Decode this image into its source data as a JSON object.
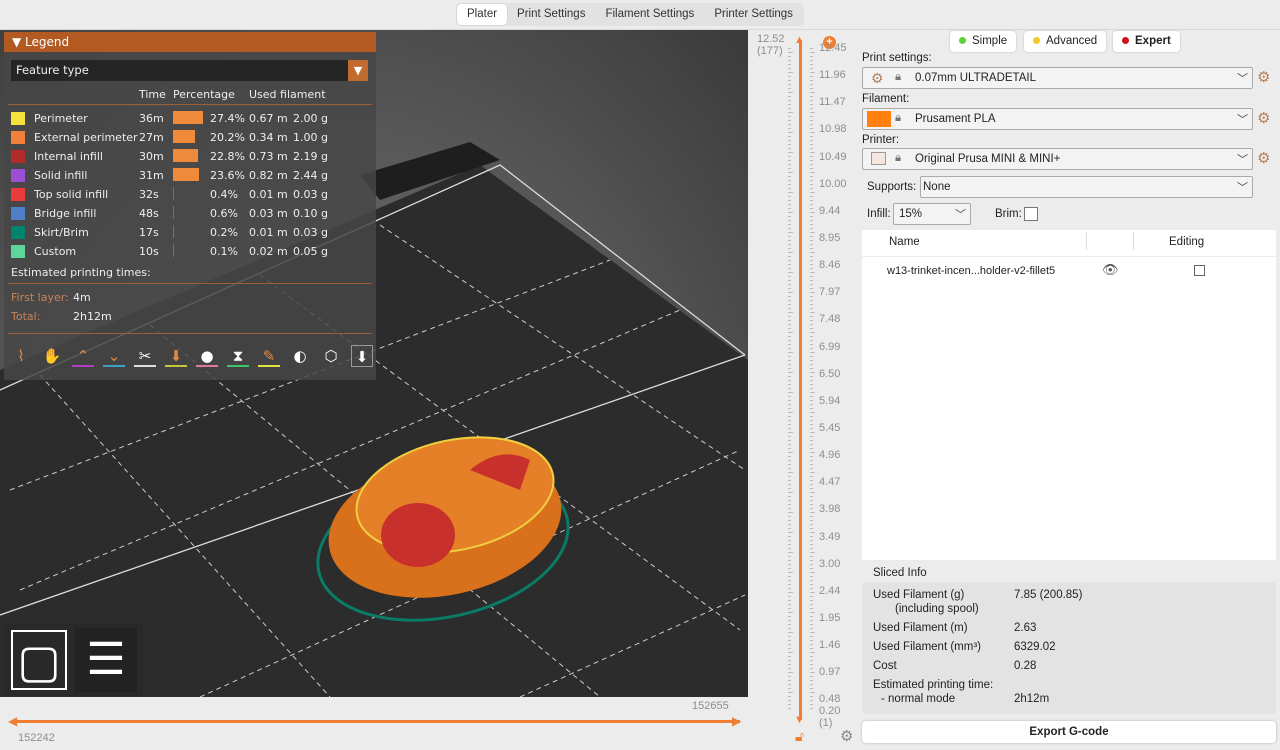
{
  "tabs": [
    "Plater",
    "Print Settings",
    "Filament Settings",
    "Printer Settings"
  ],
  "legend": {
    "title": "Legend",
    "view_type": "Feature type",
    "headers": {
      "time": "Time",
      "percentage": "Percentage",
      "used_filament": "Used filament"
    },
    "rows": [
      {
        "name": "Perimeter",
        "color": "#f5e33b",
        "time": "36m",
        "pct": "27.4%",
        "pct_value": 27.4,
        "m": "0.67 m",
        "g": "2.00 g"
      },
      {
        "name": "External perimeter",
        "color": "#f0803a",
        "time": "27m",
        "pct": "20.2%",
        "pct_value": 20.2,
        "m": "0.34 m",
        "g": "1.00 g"
      },
      {
        "name": "Internal infill",
        "color": "#b22b2b",
        "time": "30m",
        "pct": "22.8%",
        "pct_value": 22.8,
        "m": "0.73 m",
        "g": "2.19 g"
      },
      {
        "name": "Solid infill",
        "color": "#9a4fd4",
        "time": "31m",
        "pct": "23.6%",
        "pct_value": 23.6,
        "m": "0.82 m",
        "g": "2.44 g"
      },
      {
        "name": "Top solid infill",
        "color": "#eb3a3a",
        "time": "32s",
        "pct": "0.4%",
        "pct_value": 0.4,
        "m": "0.01 m",
        "g": "0.03 g"
      },
      {
        "name": "Bridge infill",
        "color": "#4f7fc6",
        "time": "48s",
        "pct": "0.6%",
        "pct_value": 0.6,
        "m": "0.03 m",
        "g": "0.10 g"
      },
      {
        "name": "Skirt/Brim",
        "color": "#00846d",
        "time": "17s",
        "pct": "0.2%",
        "pct_value": 0.2,
        "m": "0.01 m",
        "g": "0.03 g"
      },
      {
        "name": "Custom",
        "color": "#5ed59a",
        "time": "10s",
        "pct": "0.1%",
        "pct_value": 0.1,
        "m": "0.02 m",
        "g": "0.05 g"
      }
    ],
    "estimated_label": "Estimated printing times:",
    "first_layer_label": "First layer:",
    "first_layer": "4m",
    "total_label": "Total:",
    "total": "2h12m",
    "toolbar_icons": [
      "travel-icon",
      "wipe-icon",
      "retractions-icon",
      "deretractions-icon",
      "seams-icon",
      "tool-changes-icon",
      "color-changes-icon",
      "pause-icon",
      "custom-gcode-icon",
      "center-of-gravity-icon",
      "shells-icon",
      "tool-marker-icon"
    ]
  },
  "h_slider": {
    "left": "152242",
    "right": "152655"
  },
  "v_slider": {
    "top_value": "12.52",
    "top_layer": "(177)",
    "bottom_value": "0.20",
    "bottom_layer": "(1)",
    "ticks": [
      "12.45",
      "11.96",
      "11.47",
      "10.98",
      "10.49",
      "10.00",
      "9.44",
      "8.95",
      "8.46",
      "7.97",
      "7.48",
      "6.99",
      "6.50",
      "5.94",
      "5.45",
      "4.96",
      "4.47",
      "3.98",
      "3.49",
      "3.00",
      "2.44",
      "1.95",
      "1.46",
      "0.97",
      "0.48"
    ]
  },
  "modes": [
    {
      "label": "Simple",
      "color": "#5bd13a"
    },
    {
      "label": "Advanced",
      "color": "#f2c82a"
    },
    {
      "label": "Expert",
      "color": "#d0101a"
    }
  ],
  "print_settings": {
    "label": "Print settings:",
    "value": "0.07mm ULTRADETAIL"
  },
  "filament": {
    "label": "Filament:",
    "value": "Prusament PLA",
    "color": "#ff7f0f"
  },
  "printer": {
    "label": "Printer:",
    "value": "Original Prusa MINI & MINI+"
  },
  "supports": {
    "label": "Supports:",
    "value": "None"
  },
  "infill": {
    "label": "Infill:",
    "value": "15%"
  },
  "brim": {
    "label": "Brim:",
    "checked": false
  },
  "object_list": {
    "headers": {
      "name": "Name",
      "editing": "Editing"
    },
    "items": [
      {
        "name": "w13-trinket-incen...holder-v2-fillet5"
      }
    ]
  },
  "sliced_info": {
    "title": "Sliced Info",
    "rows": [
      {
        "label": "Used Filament (g)",
        "sub": "(including spool)",
        "value": "7.85 (200.85)"
      },
      {
        "label": "Used Filament (m)",
        "value": "2.63"
      },
      {
        "label": "Used Filament (mm³)",
        "value": "6329.02"
      },
      {
        "label": "Cost",
        "value": "0.28"
      },
      {
        "label": "Estimated printing time:",
        "sub": "- normal mode",
        "value": "2h12m"
      }
    ]
  },
  "export_label": "Export G-code"
}
